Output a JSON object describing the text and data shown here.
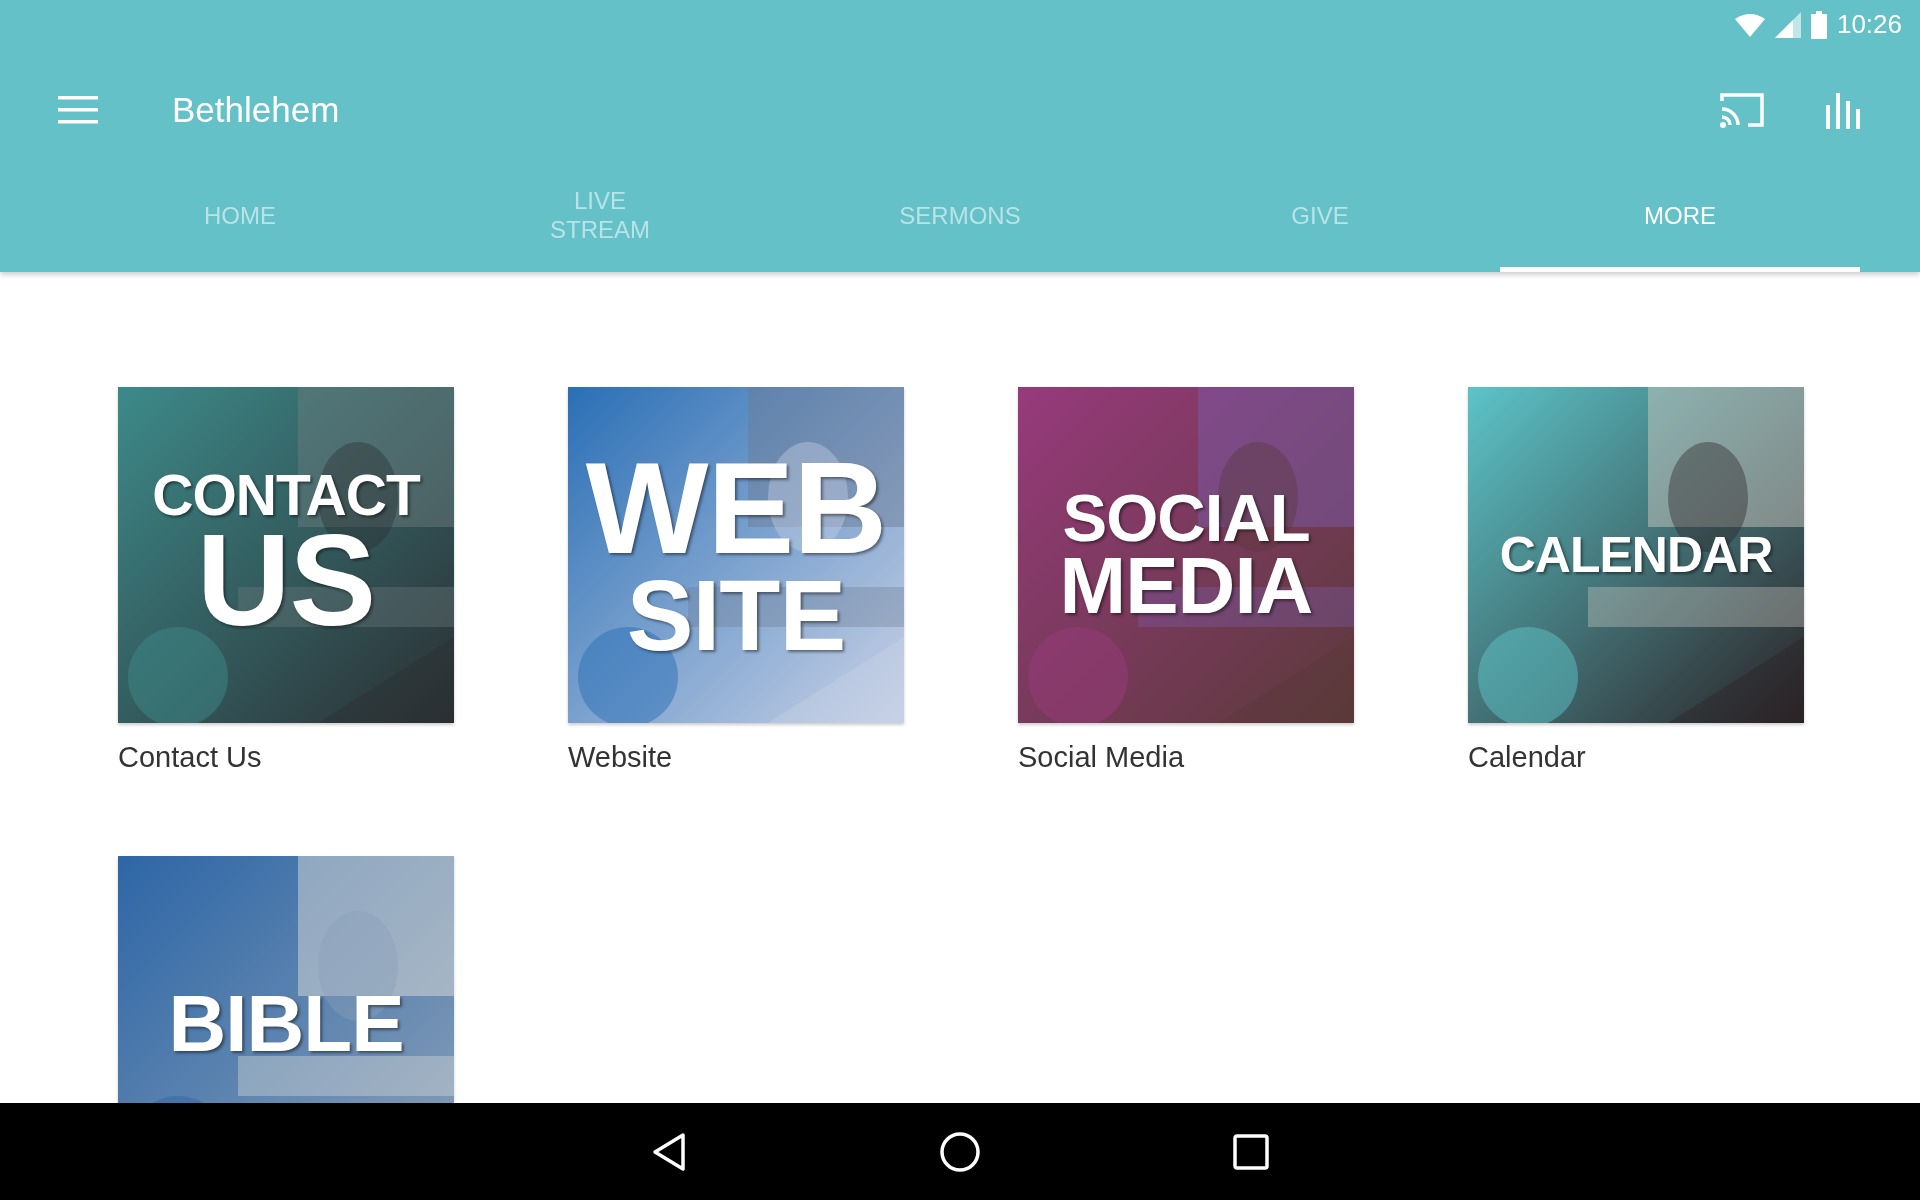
{
  "status_bar": {
    "time": "10:26"
  },
  "toolbar": {
    "title": "Bethlehem"
  },
  "tabs": [
    {
      "label": "HOME",
      "selected": false
    },
    {
      "label": "LIVE\nSTREAM",
      "selected": false
    },
    {
      "label": "SERMONS",
      "selected": false
    },
    {
      "label": "GIVE",
      "selected": false
    },
    {
      "label": "MORE",
      "selected": true
    }
  ],
  "tiles": [
    {
      "tile_text": [
        "CONTACT",
        "US"
      ],
      "label": "Contact Us"
    },
    {
      "tile_text": [
        "WEB",
        "SITE"
      ],
      "label": "Website"
    },
    {
      "tile_text": [
        "SOCIAL",
        "MEDIA"
      ],
      "label": "Social Media"
    },
    {
      "tile_text": [
        "CALENDAR"
      ],
      "label": "Calendar"
    },
    {
      "tile_text": [
        "BIBLE"
      ]
    }
  ]
}
